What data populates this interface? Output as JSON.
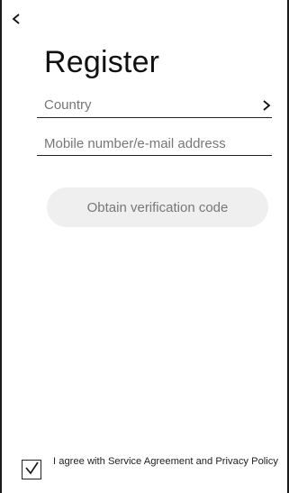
{
  "header": {
    "back_icon": "chevron-left-icon"
  },
  "page": {
    "title": "Register"
  },
  "form": {
    "country_label": "Country",
    "country_chevron_icon": "chevron-right-icon",
    "contact_placeholder": "Mobile number/e-mail address",
    "contact_value": ""
  },
  "actions": {
    "verify_label": "Obtain verification code"
  },
  "agreement": {
    "checked": true,
    "check_icon": "checkmark-icon",
    "text": "I agree with Service Agreement and Privacy Policy"
  },
  "colors": {
    "background": "#ffffff",
    "text_primary": "#111111",
    "text_secondary": "#777777",
    "button_bg": "#efefef",
    "border": "#222222"
  }
}
